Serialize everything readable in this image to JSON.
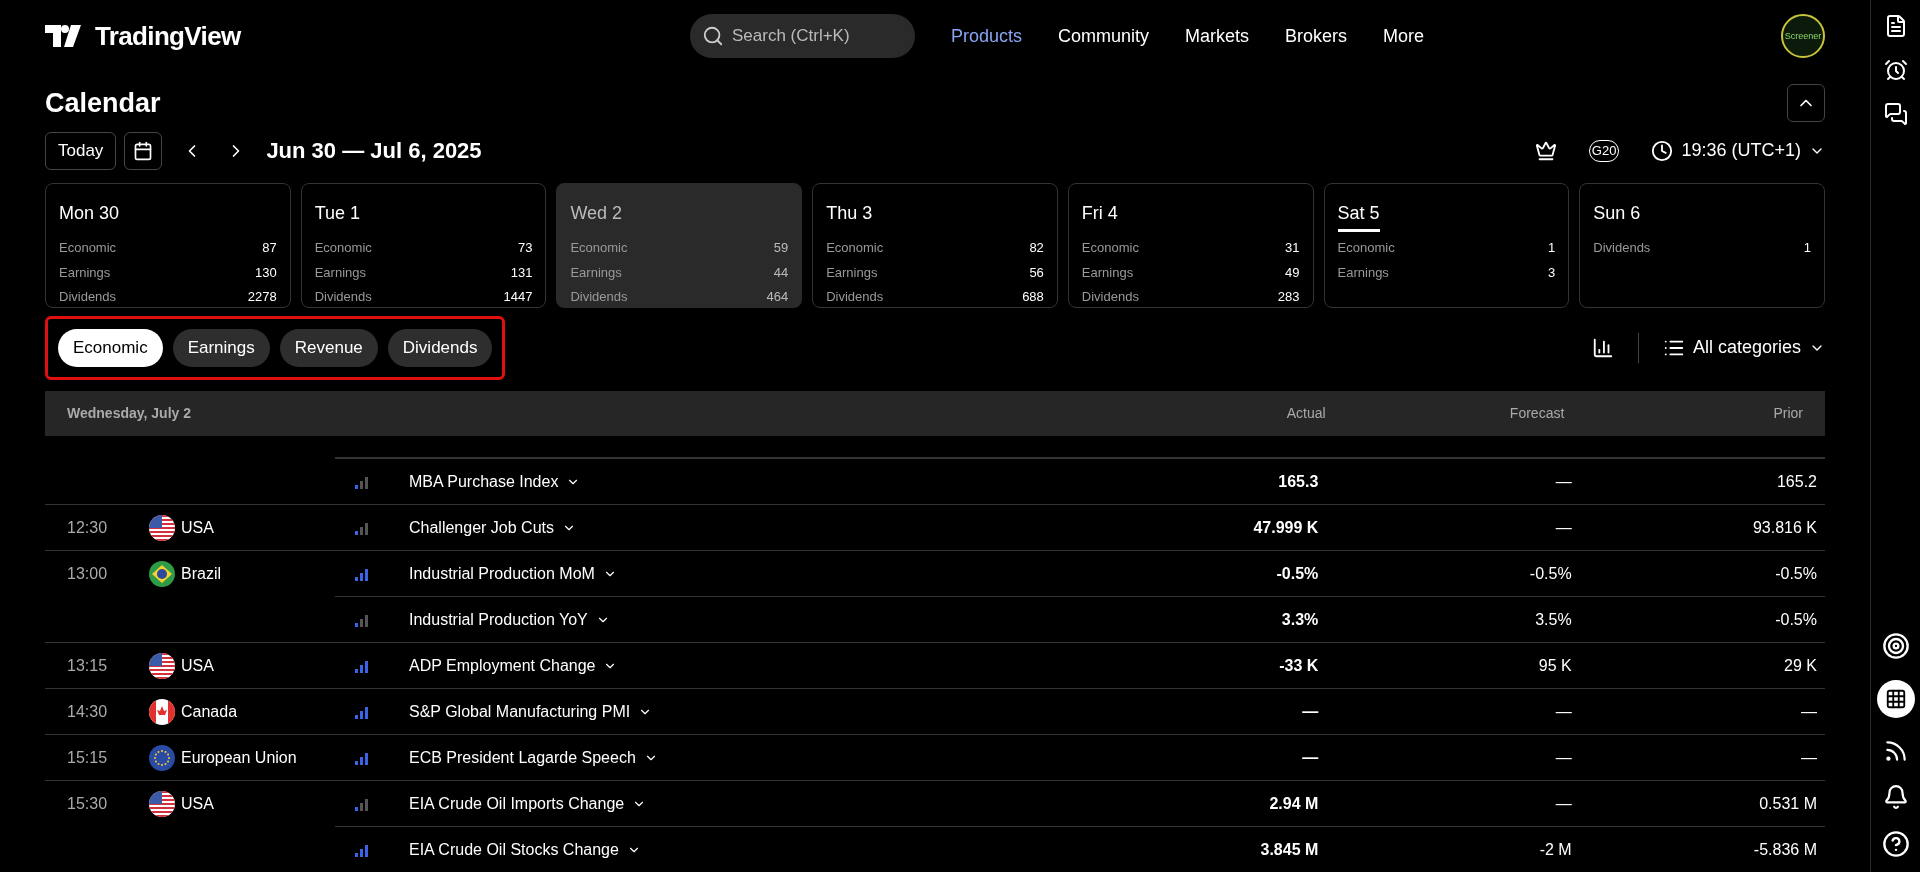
{
  "header": {
    "logo": "TradingView",
    "search": {
      "placeholder": "Search (Ctrl+K)"
    },
    "nav": [
      {
        "label": "Products",
        "selected": true
      },
      {
        "label": "Community",
        "selected": false
      },
      {
        "label": "Markets",
        "selected": false
      },
      {
        "label": "Brokers",
        "selected": false
      },
      {
        "label": "More",
        "selected": false
      }
    ],
    "avatar": "Screener"
  },
  "page": {
    "title": "Calendar",
    "today_button": "Today",
    "range": "Jun 30 — Jul 6, 2025",
    "g20": "G20",
    "time": "19:36 (UTC+1)"
  },
  "days": [
    {
      "label": "Mon 30",
      "selected": false,
      "today": false,
      "stats": [
        {
          "label": "Economic",
          "count": "87"
        },
        {
          "label": "Earnings",
          "count": "130"
        },
        {
          "label": "Dividends",
          "count": "2278"
        }
      ]
    },
    {
      "label": "Tue 1",
      "selected": false,
      "today": false,
      "stats": [
        {
          "label": "Economic",
          "count": "73"
        },
        {
          "label": "Earnings",
          "count": "131"
        },
        {
          "label": "Dividends",
          "count": "1447"
        }
      ]
    },
    {
      "label": "Wed 2",
      "selected": true,
      "today": false,
      "stats": [
        {
          "label": "Economic",
          "count": "59"
        },
        {
          "label": "Earnings",
          "count": "44"
        },
        {
          "label": "Dividends",
          "count": "464"
        }
      ]
    },
    {
      "label": "Thu 3",
      "selected": false,
      "today": false,
      "stats": [
        {
          "label": "Economic",
          "count": "82"
        },
        {
          "label": "Earnings",
          "count": "56"
        },
        {
          "label": "Dividends",
          "count": "688"
        }
      ]
    },
    {
      "label": "Fri 4",
      "selected": false,
      "today": false,
      "stats": [
        {
          "label": "Economic",
          "count": "31"
        },
        {
          "label": "Earnings",
          "count": "49"
        },
        {
          "label": "Dividends",
          "count": "283"
        }
      ]
    },
    {
      "label": "Sat 5",
      "selected": false,
      "today": true,
      "stats": [
        {
          "label": "Economic",
          "count": "1"
        },
        {
          "label": "Earnings",
          "count": "3"
        }
      ]
    },
    {
      "label": "Sun 6",
      "selected": false,
      "today": false,
      "stats": [
        {
          "label": "Dividends",
          "count": "1"
        }
      ]
    }
  ],
  "tabs": {
    "highlighted": true,
    "items": [
      {
        "label": "Economic",
        "selected": true
      },
      {
        "label": "Earnings",
        "selected": false
      },
      {
        "label": "Revenue",
        "selected": false
      },
      {
        "label": "Dividends",
        "selected": false
      }
    ]
  },
  "filter": "All categories",
  "table": {
    "date": "Wednesday, July 2",
    "columns": [
      "Actual",
      "Forecast",
      "Prior"
    ],
    "rows": [
      {
        "time": "",
        "country": "",
        "event": "MBA Purchase Index",
        "level": 0.34,
        "actual": "165.3",
        "forecast": "—",
        "prior": "165.2"
      },
      {
        "time": "12:30",
        "country": "USA",
        "kind": "usa",
        "event": "Challenger Job Cuts",
        "level": 0.34,
        "actual": "47.999 K",
        "forecast": "—",
        "prior": "93.816 K"
      },
      {
        "time": "13:00",
        "country": "Brazil",
        "kind": "brazil",
        "event": "Industrial Production MoM",
        "level": 1,
        "actual": "-0.5%",
        "forecast": "-0.5%",
        "prior": "-0.5%"
      },
      {
        "time": "",
        "country": "",
        "event": "Industrial Production YoY",
        "level": 0.34,
        "actual": "3.3%",
        "forecast": "3.5%",
        "prior": "-0.5%"
      },
      {
        "time": "13:15",
        "country": "USA",
        "kind": "usa",
        "event": "ADP Employment Change",
        "level": 1,
        "actual": "-33 K",
        "forecast": "95 K",
        "prior": "29 K"
      },
      {
        "time": "14:30",
        "country": "Canada",
        "kind": "canada",
        "event": "S&P Global Manufacturing PMI",
        "level": 1,
        "actual": "—",
        "forecast": "—",
        "prior": "—"
      },
      {
        "time": "15:15",
        "country": "European Union",
        "kind": "eu",
        "event": "ECB President Lagarde Speech",
        "level": 1,
        "actual": "—",
        "forecast": "—",
        "prior": "—"
      },
      {
        "time": "15:30",
        "country": "USA",
        "kind": "usa",
        "event": "EIA Crude Oil Imports Change",
        "level": 0.34,
        "actual": "2.94 M",
        "forecast": "—",
        "prior": "0.531 M"
      },
      {
        "time": "",
        "country": "",
        "event": "EIA Crude Oil Stocks Change",
        "level": 1,
        "actual": "3.845 M",
        "forecast": "-2 M",
        "prior": "-5.836 M"
      }
    ]
  }
}
